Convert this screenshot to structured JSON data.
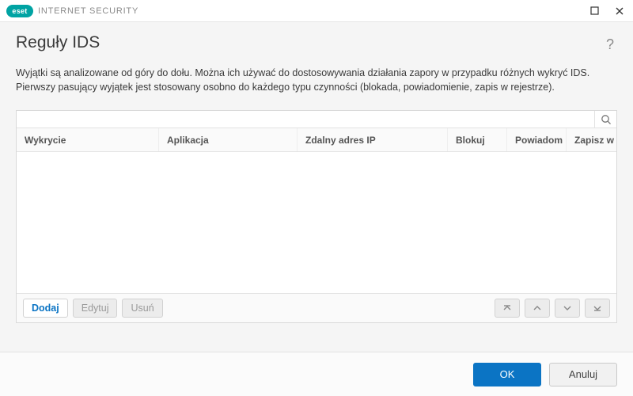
{
  "brand": {
    "logo_text": "eset",
    "product": "INTERNET SECURITY"
  },
  "page": {
    "title": "Reguły IDS",
    "description": "Wyjątki są analizowane od góry do dołu. Można ich używać do dostosowywania działania zapory w przypadku różnych wykryć IDS. Pierwszy pasujący wyjątek jest stosowany osobno do każdego typu czynności (blokada, powiadomienie, zapis w rejestrze)."
  },
  "search": {
    "value": "",
    "placeholder": ""
  },
  "columns": {
    "c1": "Wykrycie",
    "c2": "Aplikacja",
    "c3": "Zdalny adres IP",
    "c4": "Blokuj",
    "c5": "Powiadom",
    "c6": "Zapisz w dzie"
  },
  "rows": [],
  "actions": {
    "add": "Dodaj",
    "edit": "Edytuj",
    "delete": "Usuń"
  },
  "dialog": {
    "ok": "OK",
    "cancel": "Anuluj"
  }
}
